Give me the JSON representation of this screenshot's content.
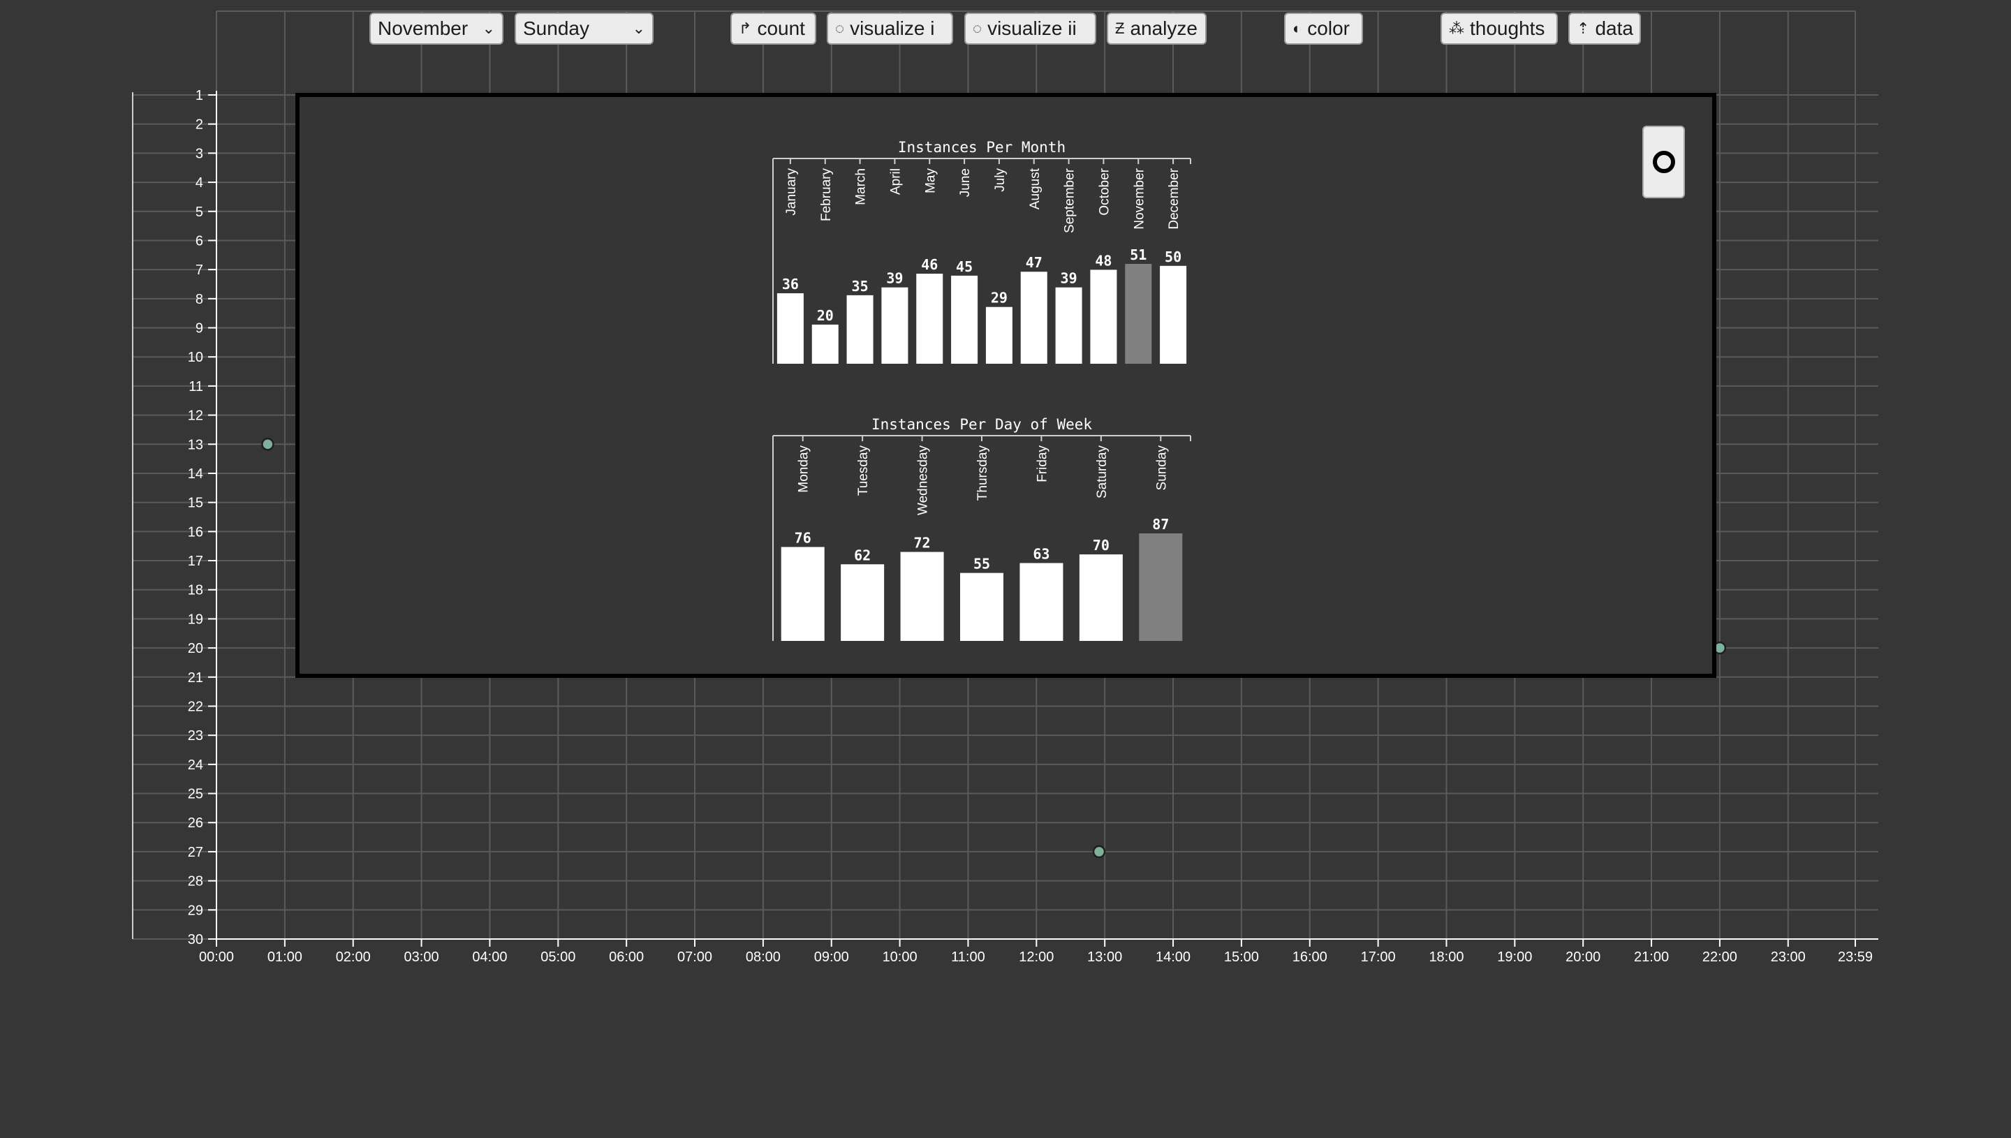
{
  "toolbar": {
    "month_select": {
      "value": "November"
    },
    "day_select": {
      "value": "Sunday"
    },
    "buttons": [
      {
        "key": "count",
        "icon": "count-icon",
        "glyph": "↱",
        "label": "count"
      },
      {
        "key": "visualize_i",
        "icon": "visualize-i-icon",
        "glyph": "◌",
        "label": "visualize i"
      },
      {
        "key": "visualize_ii",
        "icon": "visualize-ii-icon",
        "glyph": "◌",
        "label": "visualize ii"
      },
      {
        "key": "analyze",
        "icon": "analyze-icon",
        "glyph": "Ƶ",
        "label": "analyze"
      },
      {
        "key": "color",
        "icon": "color-icon",
        "glyph": "◐",
        "label": "color"
      },
      {
        "key": "thoughts",
        "icon": "thoughts-icon",
        "glyph": "⁂",
        "label": "thoughts"
      },
      {
        "key": "data",
        "icon": "data-icon",
        "glyph": "⇡",
        "label": "data"
      }
    ]
  },
  "colors": {
    "background": "#363636",
    "grid": "#5a5a5a",
    "point_fill": "#7fb09a",
    "bar": "#ffffff",
    "bar_highlight": "#808080",
    "panel_border": "#000000"
  },
  "chart_data": [
    {
      "type": "scatter",
      "title": "",
      "xlabel": "",
      "ylabel": "",
      "x_ticks": [
        "00:00",
        "01:00",
        "02:00",
        "03:00",
        "04:00",
        "05:00",
        "06:00",
        "07:00",
        "08:00",
        "09:00",
        "10:00",
        "11:00",
        "12:00",
        "13:00",
        "14:00",
        "15:00",
        "16:00",
        "17:00",
        "18:00",
        "19:00",
        "20:00",
        "21:00",
        "22:00",
        "23:00",
        "23:59"
      ],
      "y_ticks": [
        "1",
        "2",
        "3",
        "4",
        "5",
        "6",
        "7",
        "8",
        "9",
        "10",
        "11",
        "12",
        "13",
        "14",
        "15",
        "16",
        "17",
        "18",
        "19",
        "20",
        "21",
        "22",
        "23",
        "24",
        "25",
        "26",
        "27",
        "28",
        "29",
        "30"
      ],
      "xlim": [
        "00:00",
        "23:59"
      ],
      "ylim": [
        1,
        30
      ],
      "grid": true,
      "points": [
        {
          "x": "00:45",
          "y": 13
        },
        {
          "x": "12:55",
          "y": 27
        },
        {
          "x": "22:00",
          "y": 20
        }
      ]
    },
    {
      "type": "bar",
      "title": "Instances Per Month",
      "categories": [
        "January",
        "February",
        "March",
        "April",
        "May",
        "June",
        "July",
        "August",
        "September",
        "October",
        "November",
        "December"
      ],
      "values": [
        36,
        20,
        35,
        39,
        46,
        45,
        29,
        47,
        39,
        48,
        51,
        50
      ],
      "highlighted": "November"
    },
    {
      "type": "bar",
      "title": "Instances Per Day of Week",
      "categories": [
        "Monday",
        "Tuesday",
        "Wednesday",
        "Thursday",
        "Friday",
        "Saturday",
        "Sunday"
      ],
      "values": [
        76,
        62,
        72,
        55,
        63,
        70,
        87
      ],
      "highlighted": "Sunday"
    }
  ]
}
